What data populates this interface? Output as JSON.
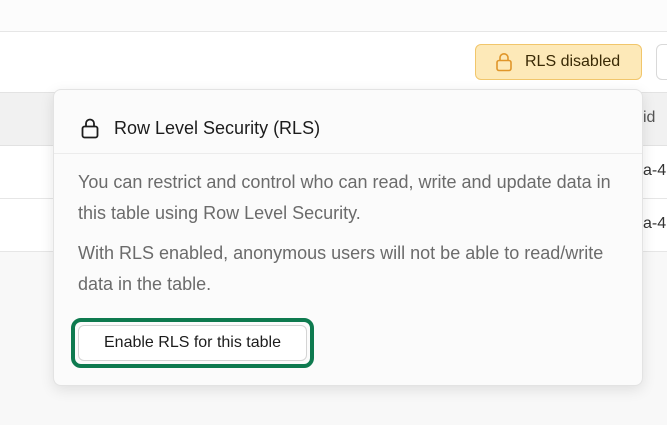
{
  "toolbar": {
    "rls_button_label": "RLS disabled",
    "rls_icon": "lock-icon",
    "accent_warning_bg": "#fde9b8",
    "accent_warning_border": "#f1c66b"
  },
  "table": {
    "visible_column_header": "id",
    "rows": [
      {
        "visible_cell": "a-4"
      },
      {
        "visible_cell": "a-4"
      }
    ]
  },
  "popover": {
    "title": "Row Level Security (RLS)",
    "title_icon": "lock-icon",
    "paragraph_1": "You can restrict and control who can read, write and update data in this table using Row Level Security.",
    "paragraph_2": "With RLS enabled, anonymous users will not be able to read/write data in the table.",
    "enable_button_label": "Enable RLS for this table",
    "focus_ring_color": "#0e7a4f"
  }
}
